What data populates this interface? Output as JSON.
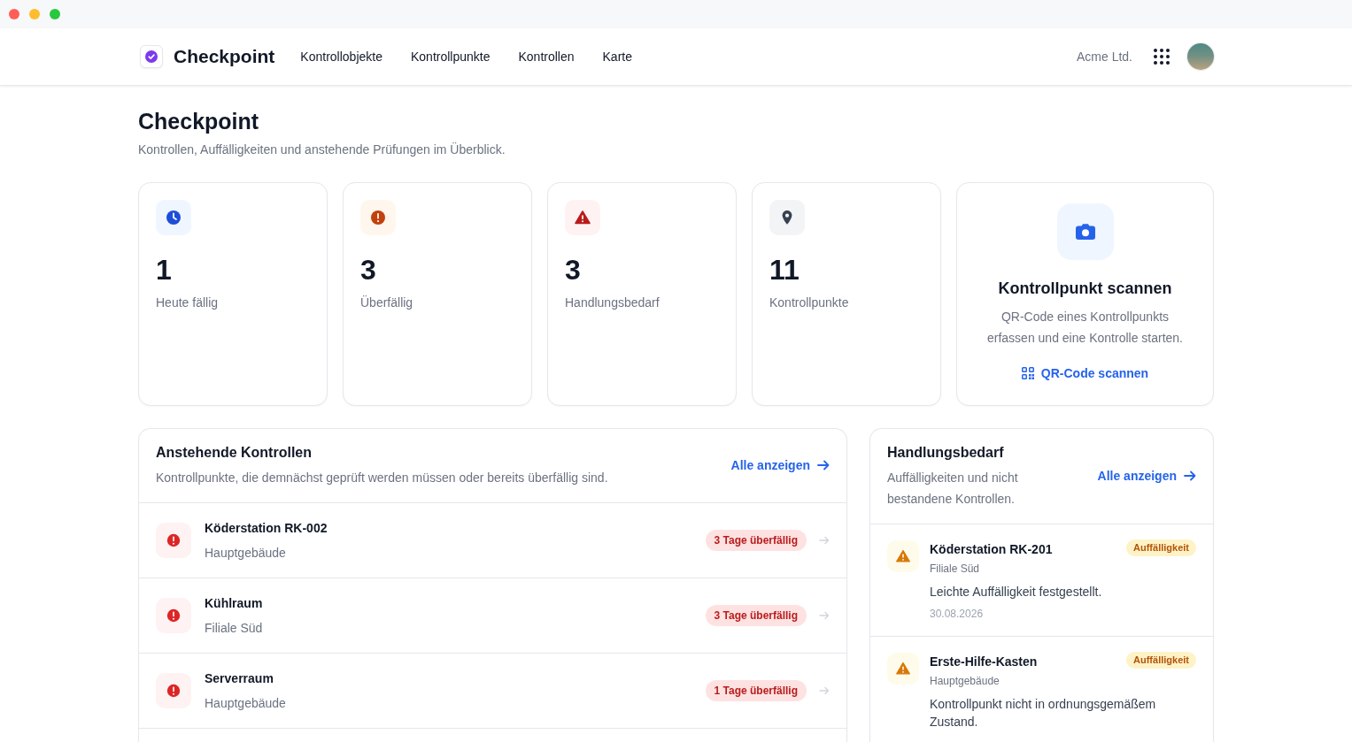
{
  "navbar": {
    "brand": "Checkpoint",
    "links": [
      "Kontrollobjekte",
      "Kontrollpunkte",
      "Kontrollen",
      "Karte"
    ],
    "organization": "Acme Ltd."
  },
  "page": {
    "title": "Checkpoint",
    "subtitle": "Kontrollen, Auffälligkeiten und anstehende Prüfungen im Überblick."
  },
  "stats": [
    {
      "kind": "due",
      "value": "1",
      "label": "Heute fällig"
    },
    {
      "kind": "overdue",
      "value": "3",
      "label": "Überfällig"
    },
    {
      "kind": "action",
      "value": "3",
      "label": "Handlungsbedarf"
    },
    {
      "kind": "points",
      "value": "11",
      "label": "Kontrollpunkte"
    }
  ],
  "scan_card": {
    "title": "Kontrollpunkt scannen",
    "description": "QR-Code eines Kontrollpunkts erfassen und eine Kontrolle starten.",
    "link": "QR-Code scannen"
  },
  "upcoming": {
    "title": "Anstehende Kontrollen",
    "subtitle": "Kontrollpunkte, die demnächst geprüft werden müssen oder bereits überfällig sind.",
    "link": "Alle anzeigen",
    "rows": [
      {
        "name": "Köderstation RK-002",
        "location": "Hauptgebäude",
        "badge": "3 Tage überfällig"
      },
      {
        "name": "Kühlraum",
        "location": "Filiale Süd",
        "badge": "3 Tage überfällig"
      },
      {
        "name": "Serverraum",
        "location": "Hauptgebäude",
        "badge": "1 Tage überfällig"
      }
    ]
  },
  "action_needed": {
    "title": "Handlungsbedarf",
    "subtitle": "Auffälligkeiten und nicht bestandene Kontrollen.",
    "link": "Alle anzeigen",
    "items": [
      {
        "name": "Köderstation RK-201",
        "location": "Filiale Süd",
        "badge": "Auffälligkeit",
        "description": "Leichte Auffälligkeit festgestellt.",
        "date": "30.08.2026"
      },
      {
        "name": "Erste-Hilfe-Kasten",
        "location": "Hauptgebäude",
        "badge": "Auffälligkeit",
        "description": "Kontrollpunkt nicht in ordnungsgemäßem Zustand."
      }
    ]
  }
}
